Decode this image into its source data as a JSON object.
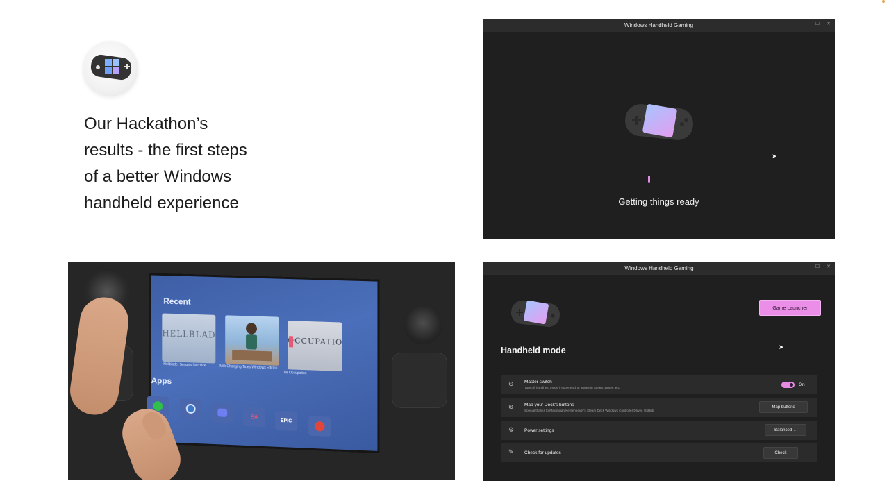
{
  "slide": {
    "headline_lines": [
      "Our Hackathon’s",
      "results - the first steps",
      "of a better Windows",
      "handheld experience"
    ]
  },
  "window_loading": {
    "title": "Windows Handheld Gaming",
    "controls": [
      "—",
      "☐",
      "✕"
    ],
    "status": "Getting things ready"
  },
  "photo": {
    "screen_heading_recent": "Recent",
    "screen_heading_apps": "Apps",
    "tiles": [
      {
        "label": "HELLBLADE",
        "caption": "Hellblade: Senua's Sacrifice"
      },
      {
        "label": "",
        "caption": "Milk Changing Tides Windows Edition"
      },
      {
        "label": "OCCUPATION",
        "caption": "The Occupation"
      }
    ],
    "app_icons": [
      "xbox-icon",
      "steam-icon",
      "discord-icon",
      "ea-icon",
      "epic-icon",
      "office-icon"
    ],
    "epic_label": "EPIC",
    "ea_label": "EA"
  },
  "window_settings": {
    "title": "Windows Handheld Gaming",
    "controls": [
      "—",
      "☐",
      "✕"
    ],
    "game_launcher": "Game Launcher",
    "heading": "Handheld mode",
    "rows": [
      {
        "title": "Master switch",
        "subtitle": "Turn off handheld mode if experiencing issues in Steam games, etc",
        "toggle_label": "On"
      },
      {
        "title": "Map your Deck's buttons",
        "subtitle": "Special thanks to Maximilian Kenfenheuer's Steam Deck Windows Controller Driver, GitHub",
        "button": "Map buttons"
      },
      {
        "title": "Power settings",
        "button": "Balanced ⌄"
      },
      {
        "title": "Check for updates",
        "button": "Check"
      }
    ]
  },
  "colors": {
    "accent_pink": "#ea8ee8",
    "window_bg": "#1f1f1f",
    "row_bg": "#2b2b2b"
  }
}
